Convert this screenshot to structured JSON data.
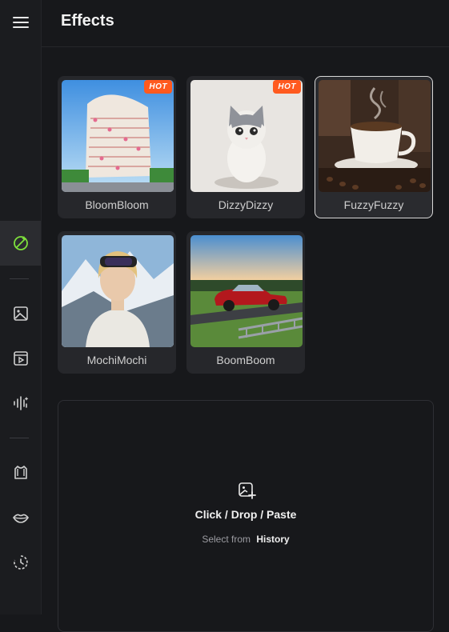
{
  "header": {
    "title": "Effects"
  },
  "sidebar": {
    "items": [
      {
        "icon": "menu-icon"
      },
      {
        "icon": "effects-icon",
        "active": true
      },
      {
        "icon": "image-icon"
      },
      {
        "icon": "video-icon"
      },
      {
        "icon": "audio-wave-icon"
      },
      {
        "icon": "shirt-icon"
      },
      {
        "icon": "lips-icon"
      },
      {
        "icon": "history-icon"
      }
    ]
  },
  "effects": [
    {
      "label": "BloomBloom",
      "badge": "HOT"
    },
    {
      "label": "DizzyDizzy",
      "badge": "HOT"
    },
    {
      "label": "FuzzyFuzzy",
      "badge": "",
      "selected": true
    },
    {
      "label": "MochiMochi",
      "badge": ""
    },
    {
      "label": "BoomBoom",
      "badge": ""
    }
  ],
  "upload": {
    "title": "Click / Drop / Paste",
    "select_prefix": "Select from",
    "select_link": "History"
  },
  "colors": {
    "accent": "#7ee03c",
    "badge": "#ff5a1f",
    "background": "#17181b"
  }
}
